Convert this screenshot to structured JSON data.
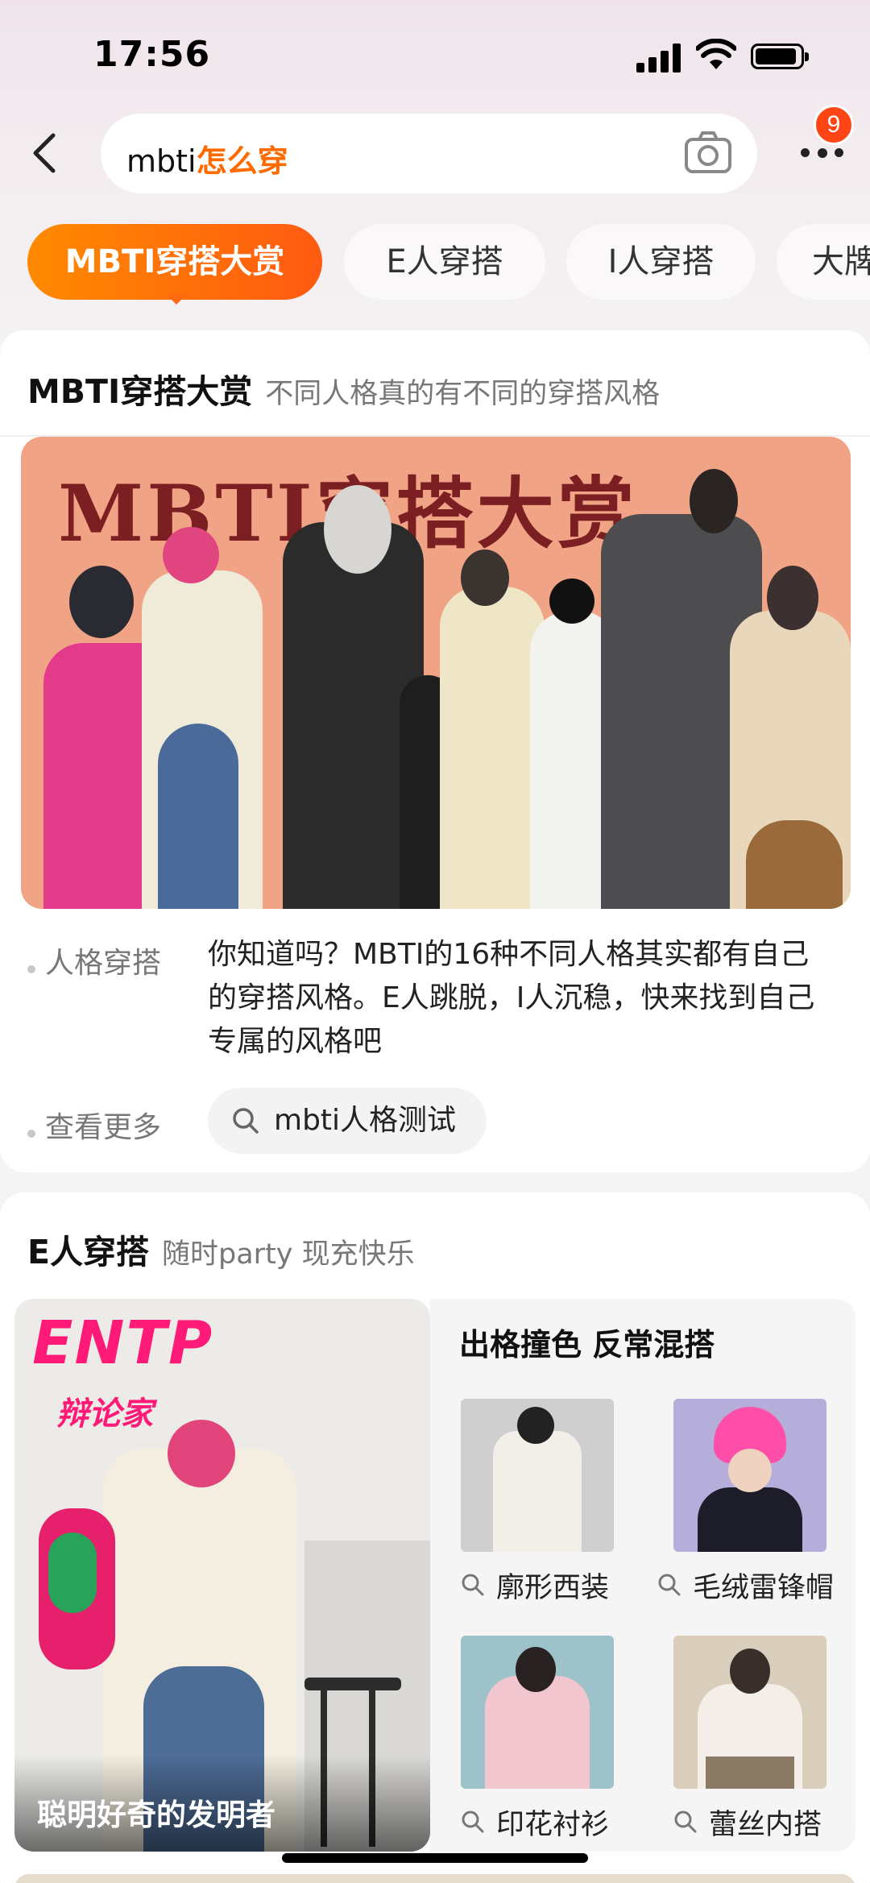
{
  "status_bar": {
    "time": "17:56"
  },
  "header": {
    "search_prefix": "mbti",
    "search_highlight": "怎么穿",
    "notification_count": "9"
  },
  "tabs": [
    {
      "label": "MBTI穿搭大赏",
      "active": true
    },
    {
      "label": "E人穿搭",
      "active": false
    },
    {
      "label": "I人穿搭",
      "active": false
    },
    {
      "label": "大牌",
      "active": false
    }
  ],
  "section_mbti": {
    "title": "MBTI穿搭大赏",
    "subtitle": "不同人格真的有不同的穿搭风格",
    "banner_title": "MBTI穿搭大赏",
    "persona_label": "人格穿搭",
    "description": "你知道吗？MBTI的16种不同人格其实都有自己的穿搭风格。E人跳脱，I人沉稳，快来找到自己专属的风格吧",
    "more_label": "查看更多",
    "chip_label": "mbti人格测试"
  },
  "section_e": {
    "title": "E人穿搭",
    "subtitle": "随时party 现充快乐",
    "poster_type": "ENTP",
    "poster_type_name": "辩论家",
    "poster_caption": "聪明好奇的发明者",
    "panel_title": "出格撞色 反常混搭",
    "items": [
      {
        "label": "廓形西装"
      },
      {
        "label": "毛绒雷锋帽"
      },
      {
        "label": "印花衬衫"
      },
      {
        "label": "蕾丝内搭"
      }
    ]
  },
  "colors": {
    "accent": "#ff6a00",
    "badge": "#ff4416",
    "brand_pink": "#ff1a78"
  }
}
